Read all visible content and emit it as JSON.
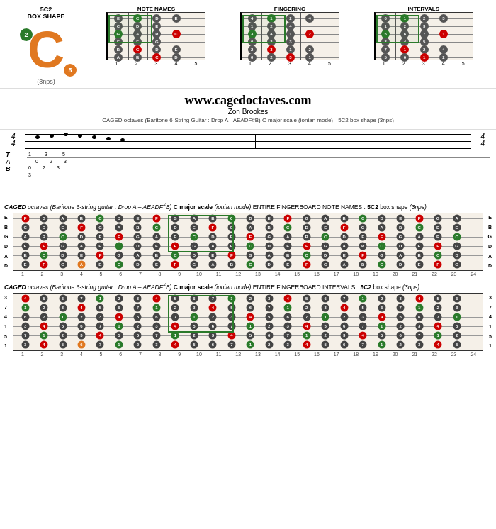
{
  "header": {
    "title": "5C2",
    "subtitle": "BOX SHAPE",
    "subtitle2": "(3nps)",
    "website": "www.cagedoctaves.com",
    "author": "Zon Brookes",
    "description": "CAGED octaves (Baritone 6-String Guitar : Drop A - AEADF#B) C major scale (ionian mode) - 5C2 box shape (3nps)"
  },
  "diagrams": [
    {
      "label": "NOTE NAMES"
    },
    {
      "label": "FINGERING"
    },
    {
      "label": "INTERVALS"
    }
  ],
  "caged_notes_title": "CAGED octaves (Baritone 6-string guitar : Drop A – AEADF#B) C major scale (ionian mode) ENTIRE FINGERBOARD NOTE NAMES : 5C2 box shape (3nps)",
  "caged_intervals_title": "CAGED octaves (Baritone 6-string guitar : Drop A – AEADF#B) C major scale (ionian mode) ENTIRE FINGERBOARD INTERVALS : 5C2 box shape (3nps)",
  "string_labels": [
    "E",
    "B",
    "G",
    "D",
    "A",
    "D"
  ],
  "string_labels_right": [
    "E",
    "B",
    "G",
    "D",
    "A",
    "D"
  ],
  "fret_numbers_24": [
    1,
    2,
    3,
    4,
    5,
    6,
    7,
    8,
    9,
    10,
    11,
    12,
    13,
    14,
    15,
    16,
    17,
    18,
    19,
    20,
    21,
    22,
    23,
    24
  ],
  "colors": {
    "red": "#c00",
    "green": "#2a7a2a",
    "orange": "#e07820",
    "gray": "#444",
    "white": "#fff"
  }
}
